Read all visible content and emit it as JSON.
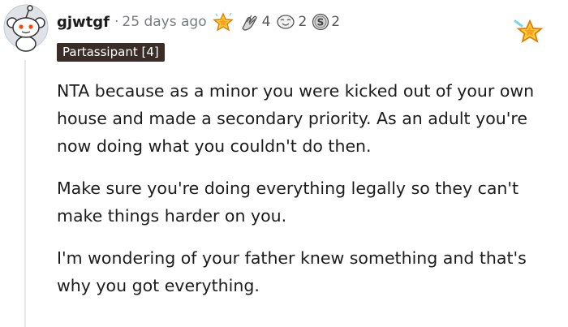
{
  "comment": {
    "username": "gjwtgf",
    "separator": "·",
    "timestamp": "25 days ago",
    "awards": [
      {
        "icon": "sparkle-star-award-icon",
        "count": ""
      },
      {
        "icon": "hands-award-icon",
        "count": "4"
      },
      {
        "icon": "wholesome-face-award-icon",
        "count": "2"
      },
      {
        "icon": "silver-coin-award-icon",
        "count": "2"
      }
    ],
    "flair": "Partassipant [4]",
    "paragraphs": [
      "NTA because as a minor you were kicked out of your own house and made a secondary priority. As an adult you're now doing what you couldn't do then.",
      "Make sure you're doing everything legally so they can't make things harder on you.",
      "I'm wondering of your father knew something and that's why you got everything."
    ]
  },
  "colors": {
    "username": "#1c1c1c",
    "meta": "#787c7e",
    "flair_bg": "#3a2d27",
    "flair_text": "#ffffff",
    "thread_line": "#e4e6e8",
    "award_gold": "#f5a623"
  }
}
